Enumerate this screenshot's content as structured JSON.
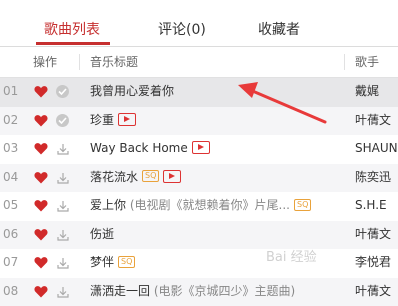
{
  "tabs": [
    {
      "label": "歌曲列表",
      "active": true
    },
    {
      "label": "评论(0)",
      "active": false
    },
    {
      "label": "收藏者",
      "active": false
    }
  ],
  "table": {
    "headers": {
      "actions": "操作",
      "title": "音乐标题",
      "artist": "歌手"
    },
    "rows": [
      {
        "num": "01",
        "title": "我曾用心爱着你",
        "sub": "",
        "sq": false,
        "mv": false,
        "artist": "戴娓",
        "downloaded": true,
        "highlighted": true
      },
      {
        "num": "02",
        "title": "珍重",
        "sub": "",
        "sq": false,
        "mv": true,
        "artist": "叶蒨文",
        "downloaded": true,
        "highlighted": false
      },
      {
        "num": "03",
        "title": "Way Back Home",
        "sub": "",
        "sq": false,
        "mv": true,
        "artist": "SHAUN",
        "downloaded": false,
        "highlighted": false
      },
      {
        "num": "04",
        "title": "落花流水",
        "sub": "",
        "sq": true,
        "mv": true,
        "artist": "陈奕迅",
        "downloaded": false,
        "highlighted": false
      },
      {
        "num": "05",
        "title": "爱上你",
        "sub": "(电视剧《就想赖着你》片尾...",
        "sq": true,
        "mv": false,
        "artist": "S.H.E",
        "downloaded": false,
        "highlighted": false
      },
      {
        "num": "06",
        "title": "伤逝",
        "sub": "",
        "sq": false,
        "mv": false,
        "artist": "叶蒨文",
        "downloaded": false,
        "highlighted": false
      },
      {
        "num": "07",
        "title": "梦伴",
        "sub": "",
        "sq": true,
        "mv": false,
        "artist": "李悦君",
        "downloaded": false,
        "highlighted": false
      },
      {
        "num": "08",
        "title": "潇洒走一回",
        "sub": "(电影《京城四少》主题曲)",
        "sq": false,
        "mv": false,
        "artist": "叶蒨文",
        "downloaded": false,
        "highlighted": false
      }
    ],
    "sq_label": "SQ"
  },
  "watermark": "Bai 经验",
  "colors": {
    "accent": "#c62f2f",
    "heart": "#d12a2a",
    "sq": "#e9a23b"
  },
  "icons": {
    "like": "heart-icon",
    "downloaded": "check-circle-icon",
    "download": "download-icon",
    "mv": "mv-play-icon"
  }
}
